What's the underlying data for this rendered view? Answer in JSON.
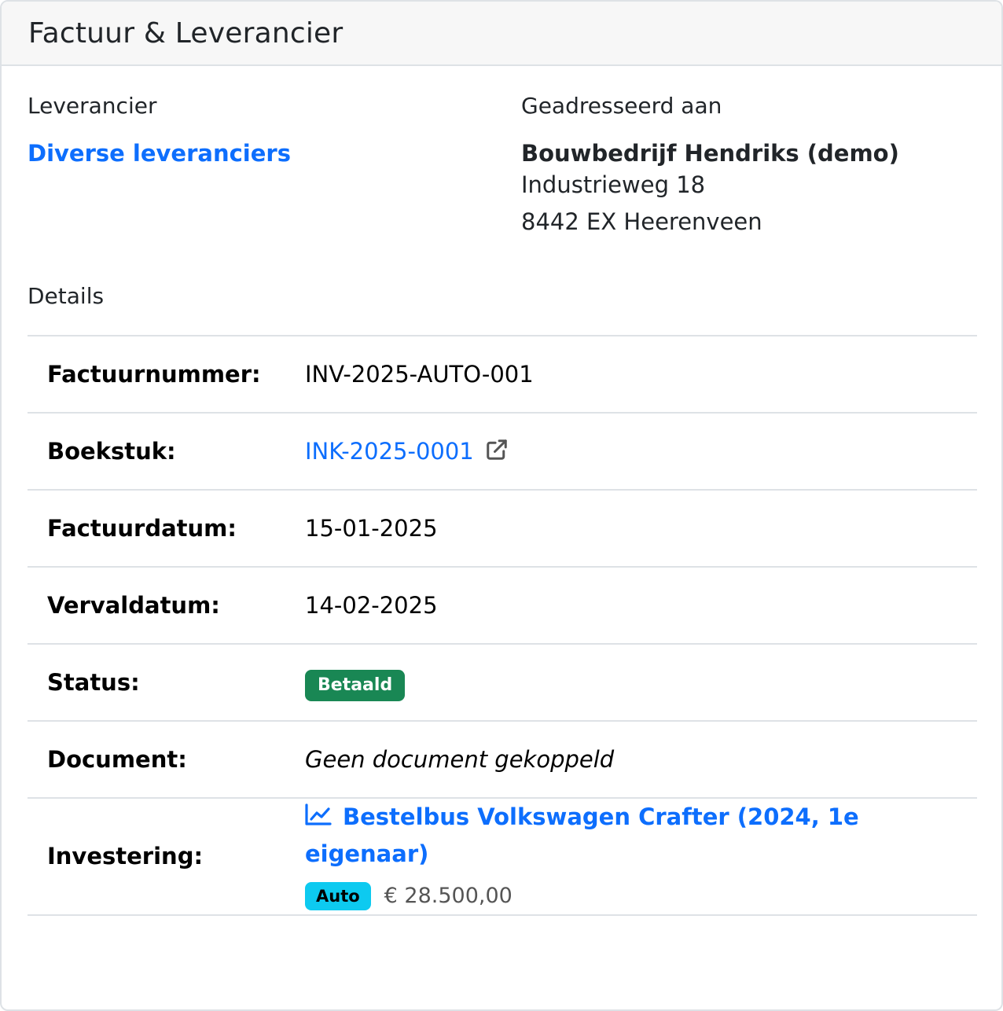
{
  "header": {
    "title": "Factuur & Leverancier"
  },
  "supplier": {
    "label": "Leverancier",
    "name": "Diverse leveranciers"
  },
  "addressed": {
    "label": "Geadresseerd aan",
    "name": "Bouwbedrijf Hendriks (demo)",
    "street": "Industrieweg 18",
    "city": "8442 EX Heerenveen"
  },
  "details": {
    "label": "Details",
    "rows": {
      "invoice_number": {
        "label": "Factuurnummer:",
        "value": "INV-2025-AUTO-001"
      },
      "booking": {
        "label": "Boekstuk:",
        "value": "INK-2025-0001"
      },
      "invoice_date": {
        "label": "Factuurdatum:",
        "value": "15-01-2025"
      },
      "due_date": {
        "label": "Vervaldatum:",
        "value": "14-02-2025"
      },
      "status": {
        "label": "Status:",
        "value": "Betaald"
      },
      "document": {
        "label": "Document:",
        "value": "Geen document gekoppeld"
      },
      "investment": {
        "label": "Investering:",
        "name": "Bestelbus Volkswagen Crafter (2024, 1e eigenaar)",
        "category": "Auto",
        "amount": "€ 28.500,00"
      }
    }
  },
  "colors": {
    "primary": "#0d6efd",
    "success": "#198754",
    "info": "#0dcaf0",
    "border": "#dee2e6"
  },
  "icons": {
    "booking_link": "external-link-icon",
    "investment": "line-chart-icon"
  }
}
